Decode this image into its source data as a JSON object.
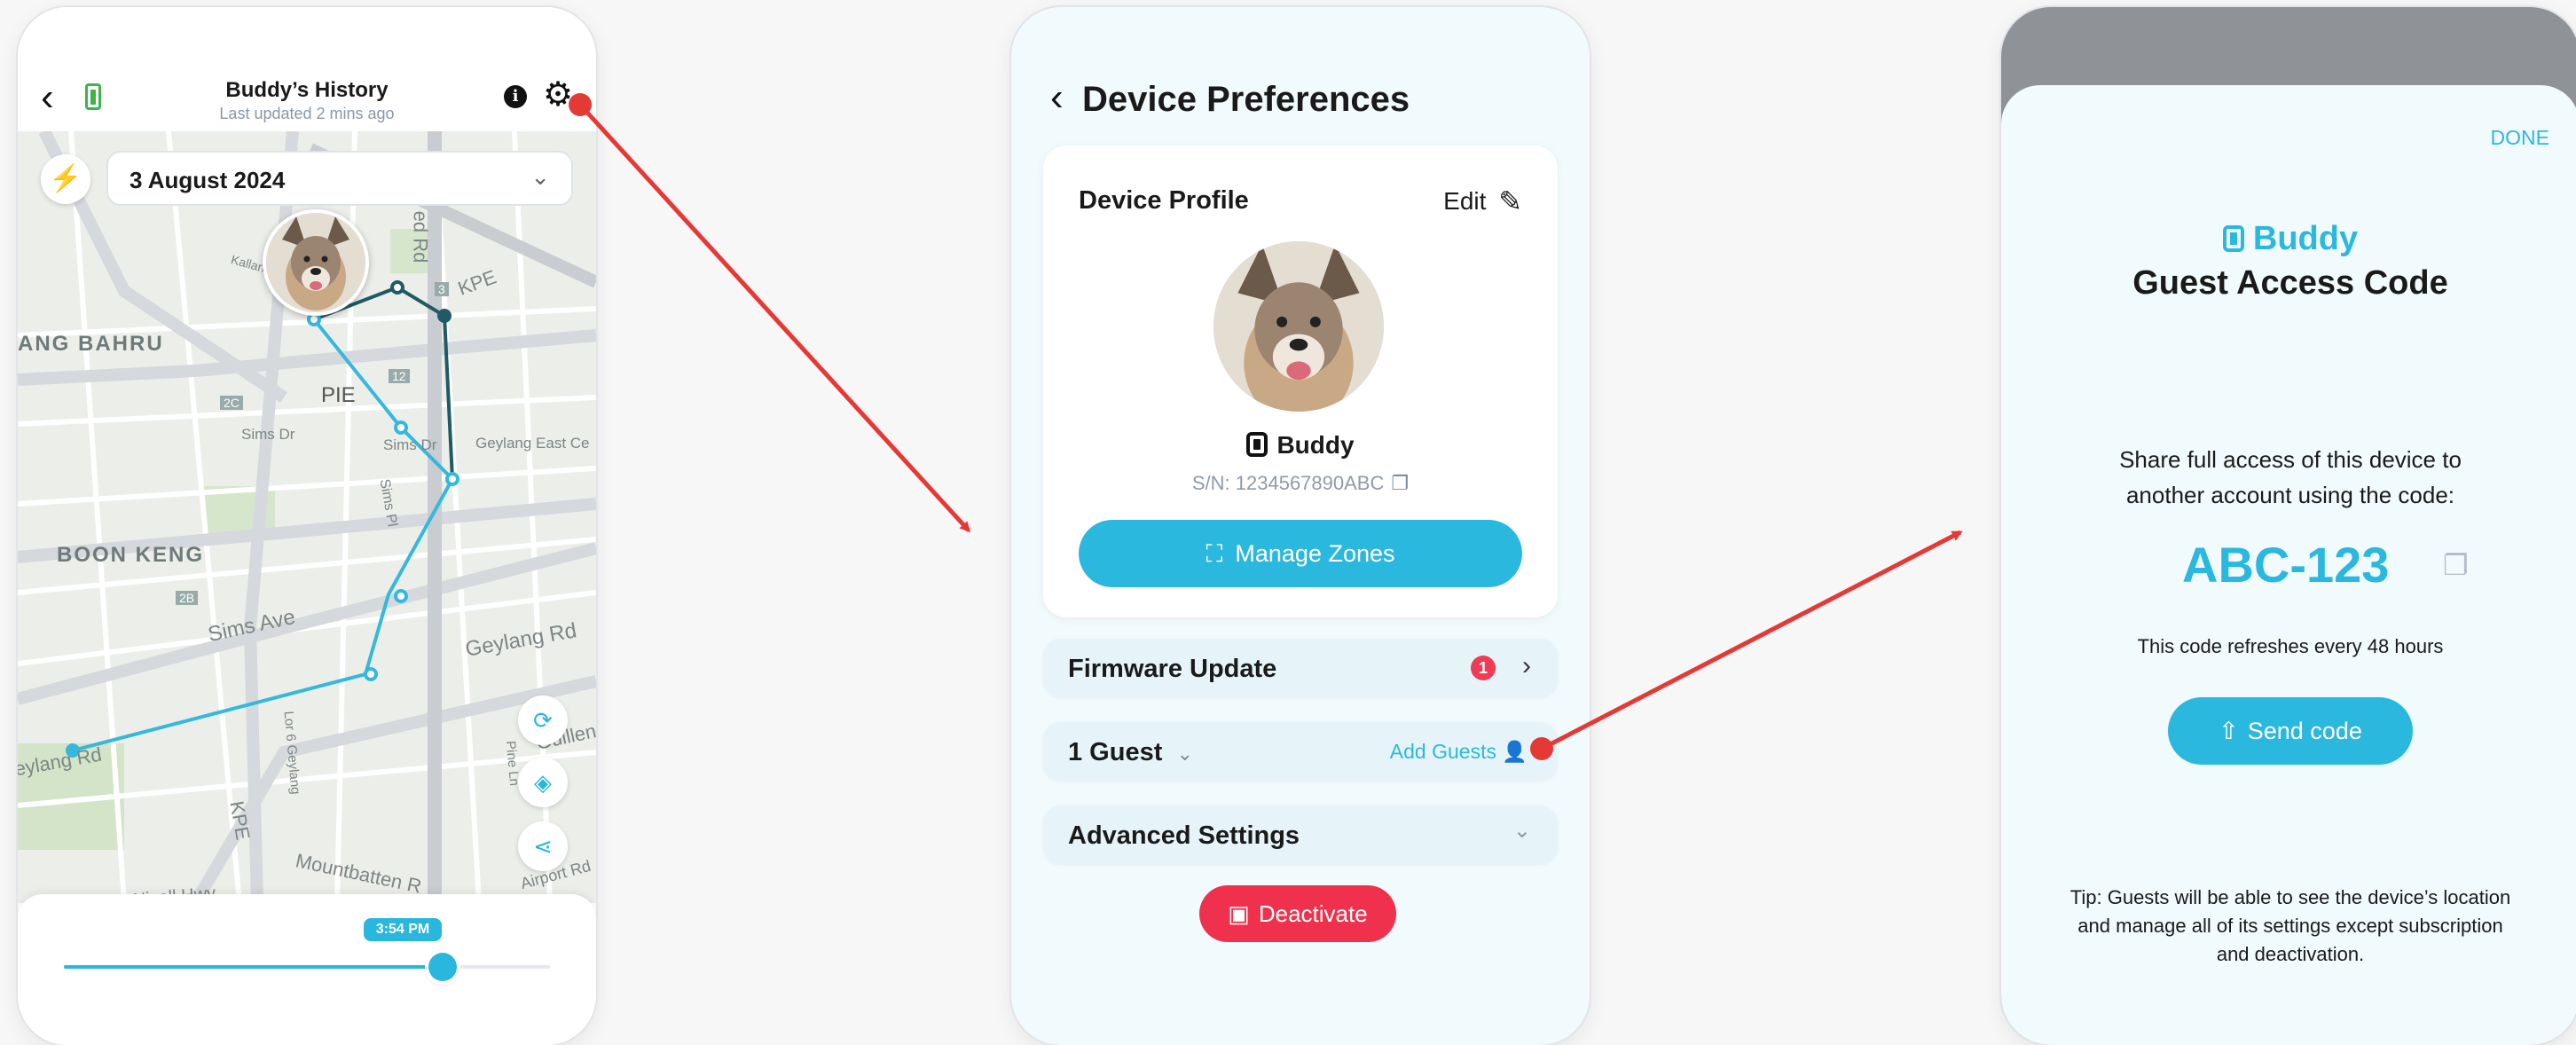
{
  "history": {
    "title": "Buddy’s History",
    "subtitle": "Last updated 2 mins ago",
    "date": "3 August 2024",
    "time_label": "3:54 PM",
    "time_progress": 0.78,
    "map_labels": {
      "tiong_bahru": "ANG BAHRU",
      "boon_keng": "BOON KENG",
      "pie": "PIE",
      "sims_ave": "Sims Ave",
      "sims_dr": "Sims Dr",
      "geylang_rd": "Geylang Rd",
      "geylang_east": "Geylang East Ce",
      "kpe_top": "KPE",
      "kpe_bottom": "KPE",
      "kallang": "Kallang",
      "mountbatten": "Mountbatten R",
      "nicoll": "Nicoll Hwy",
      "airport": "Airport Rd",
      "guillemard": "Guillen",
      "geylang_left": "eylang Rd",
      "red_rd": "ed Rd",
      "lor6": "Lor 6 Geylang",
      "pine_ln": "Pine Ln",
      "sims_pl": "Sims Pl",
      "sims_dr2": "Sims Dr",
      "road_2b": "2B",
      "road_2c": "2C",
      "road_12": "12",
      "road_3": "3"
    }
  },
  "prefs": {
    "title": "Device Preferences",
    "card_title": "Device Profile",
    "edit_label": "Edit",
    "device_name": "Buddy",
    "serial": "S/N: 1234567890ABC",
    "manage_zones": "Manage Zones",
    "firmware_label": "Firmware Update",
    "firmware_badge": "1",
    "guests_label": "1 Guest",
    "add_guests": "Add Guests",
    "advanced_label": "Advanced Settings",
    "deactivate": "Deactivate"
  },
  "guest": {
    "done": "DONE",
    "brand": "Buddy",
    "title": "Guest Access Code",
    "share_line1": "Share full access of this device to",
    "share_line2": "another account using the code:",
    "code": "ABC-123",
    "refresh": "This code refreshes every 48 hours",
    "send_code": "Send code",
    "tip_line1": "Tip: Guests will be able to see the device’s location",
    "tip_line2": "and manage all of its settings except subscription",
    "tip_line3": "and deactivation."
  },
  "colors": {
    "accent": "#2bb8de",
    "danger": "#f0314d",
    "arrow": "#e53935",
    "route_light": "#35b8dc",
    "route_dark": "#1e5b66"
  }
}
